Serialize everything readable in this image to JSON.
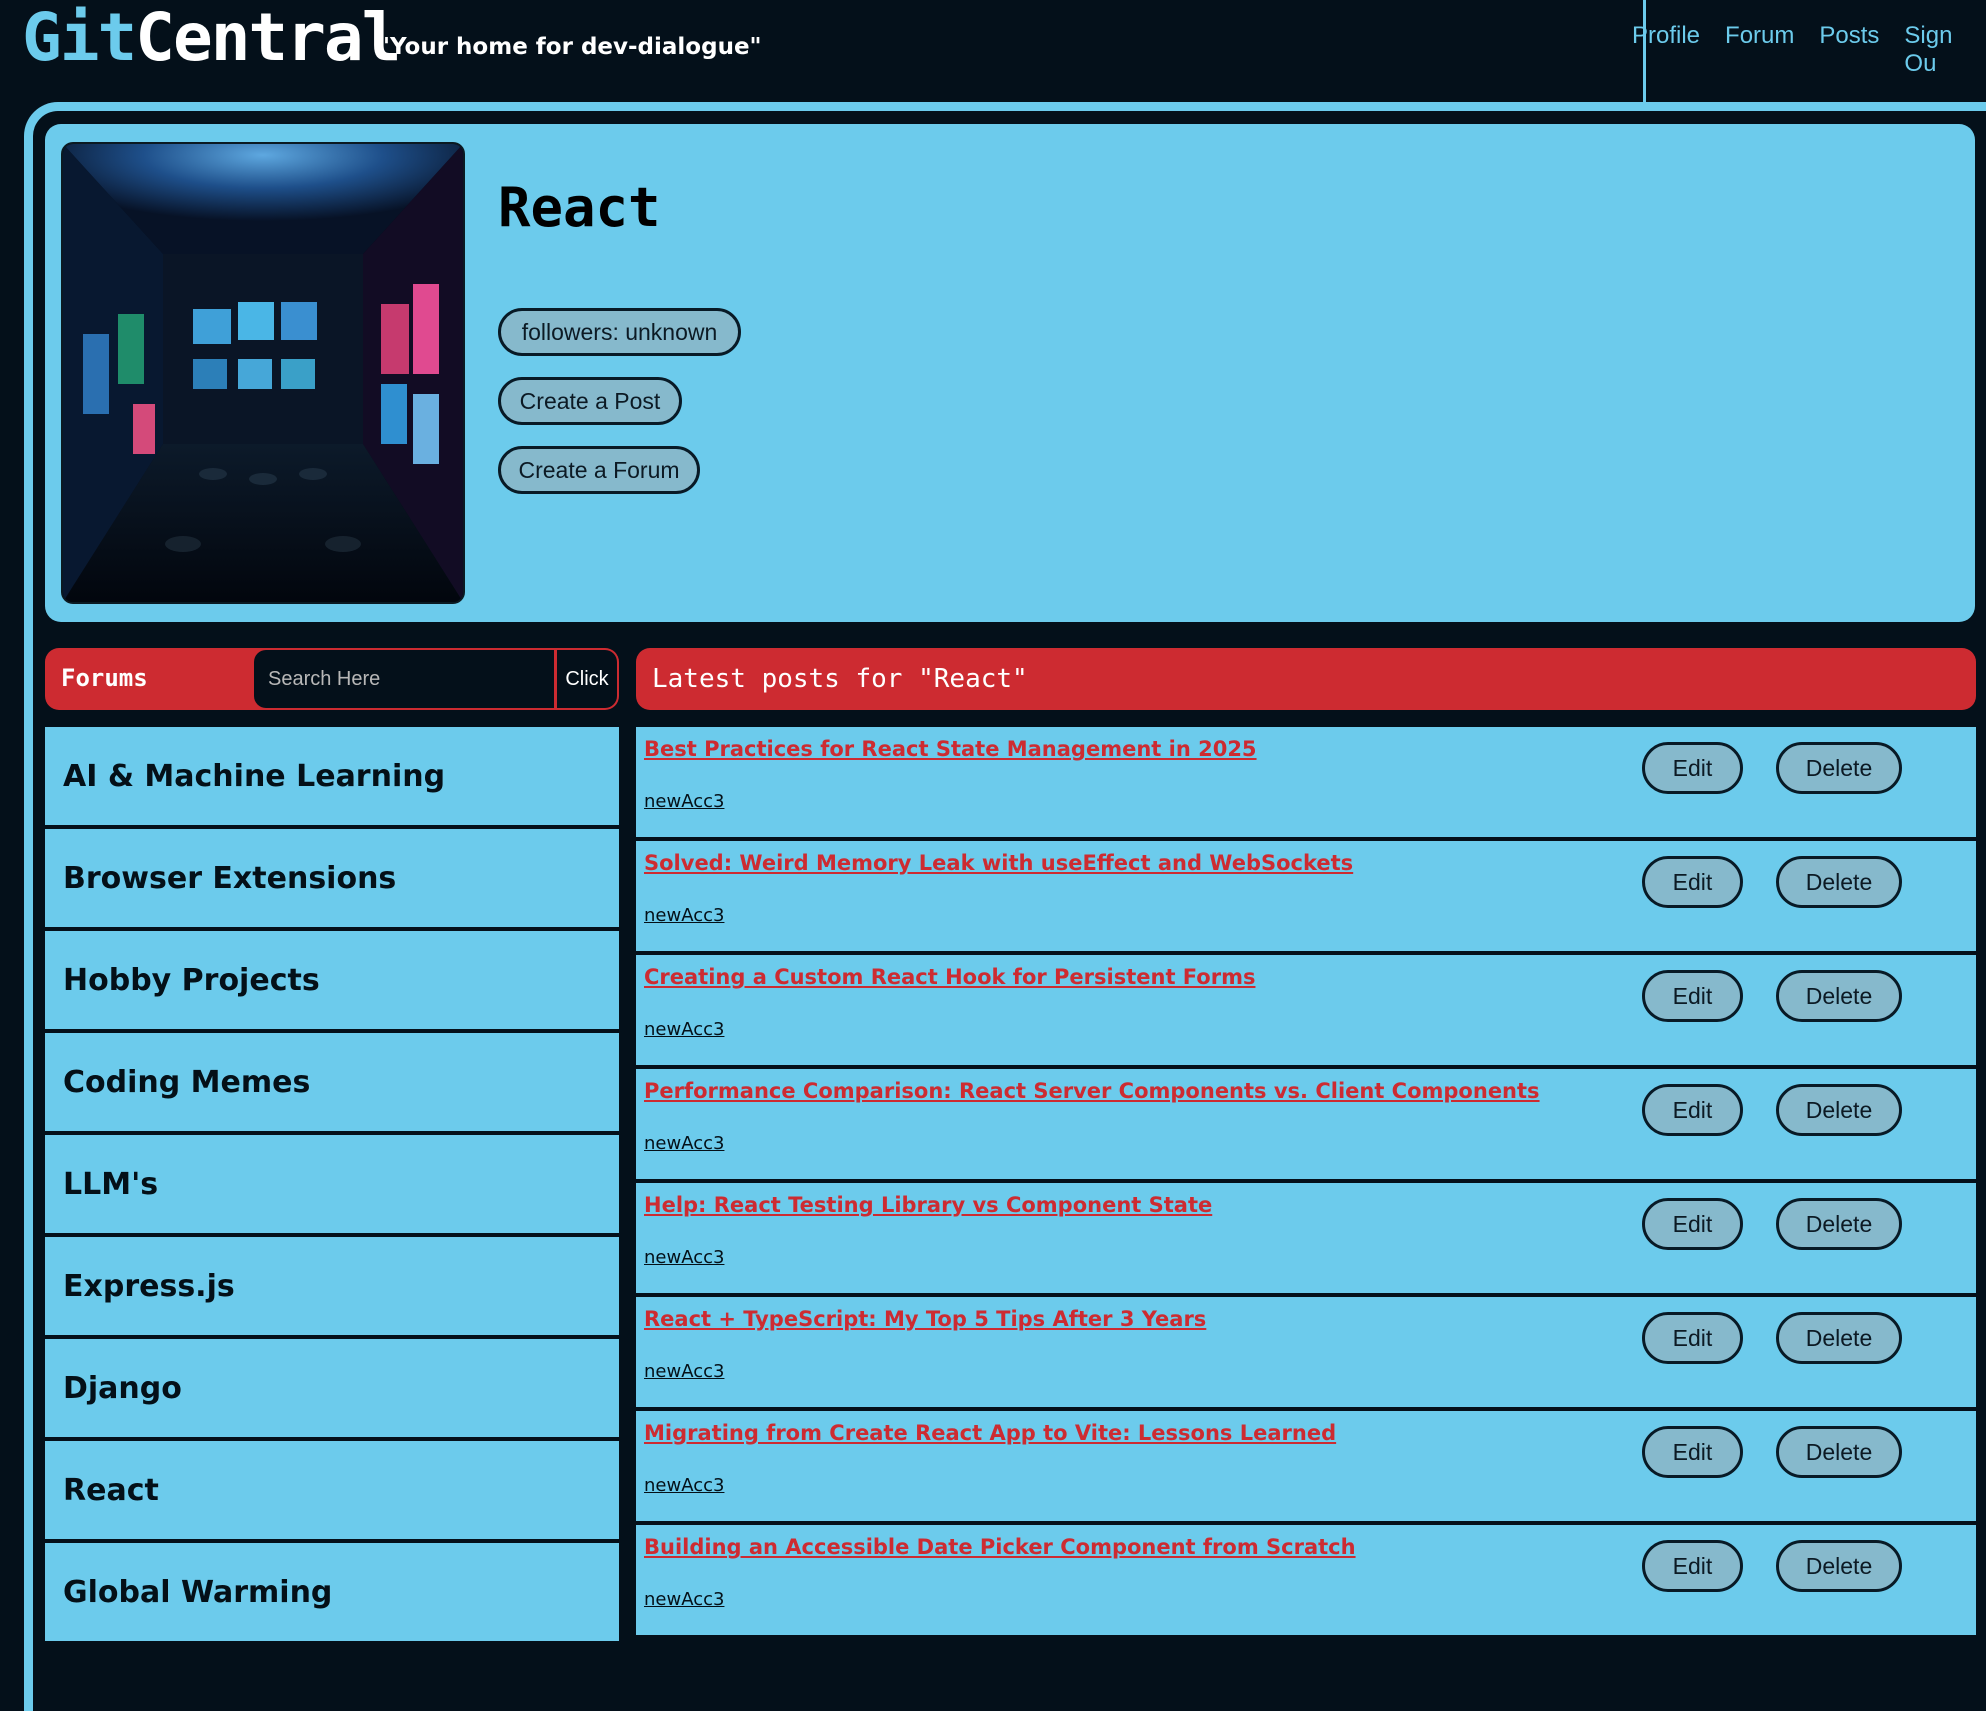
{
  "header": {
    "logo_part1": "Git",
    "logo_part2": "Central",
    "tagline": "\"Your home for dev-dialogue\"",
    "nav": [
      "Profile",
      "Forum",
      "Posts",
      "Sign Ou"
    ]
  },
  "profile": {
    "title": "React",
    "followers": "followers: unknown",
    "create_post": "Create a Post",
    "create_forum": "Create a Forum"
  },
  "forums": {
    "label": "Forums",
    "search_placeholder": "Search Here",
    "search_button": "Click",
    "items": [
      "AI & Machine Learning",
      "Browser Extensions",
      "Hobby Projects",
      "Coding Memes",
      "LLM's",
      "Express.js",
      "Django",
      "React",
      "Global Warming"
    ]
  },
  "posts": {
    "header": "Latest posts for \"React\"",
    "edit_label": "Edit",
    "delete_label": "Delete",
    "items": [
      {
        "title": "Best Practices for React State Management in 2025",
        "author": "newAcc3"
      },
      {
        "title": "Solved: Weird Memory Leak with useEffect and WebSockets",
        "author": "newAcc3"
      },
      {
        "title": "Creating a Custom React Hook for Persistent Forms",
        "author": "newAcc3"
      },
      {
        "title": "Performance Comparison: React Server Components vs. Client Components",
        "author": "newAcc3"
      },
      {
        "title": "Help: React Testing Library vs Component State",
        "author": "newAcc3"
      },
      {
        "title": "React + TypeScript: My Top 5 Tips After 3 Years",
        "author": "newAcc3"
      },
      {
        "title": "Migrating from Create React App to Vite: Lessons Learned",
        "author": "newAcc3"
      },
      {
        "title": "Building an Accessible Date Picker Component from Scratch",
        "author": "newAcc3"
      }
    ]
  },
  "colors": {
    "background": "#04101a",
    "accent_blue": "#6ccbec",
    "accent_red": "#cd2b31",
    "button_fill": "#86b9cc"
  }
}
